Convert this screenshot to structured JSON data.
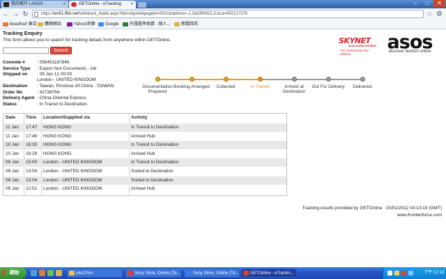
{
  "browser": {
    "tabs": [
      {
        "label": "我的帳戶 | ASOS"
      },
      {
        "label": "GETOnline - eTracking"
      }
    ],
    "window_controls": {
      "minimize": "–",
      "maximize": "□",
      "close": "✕"
    },
    "url_domain": "wn01.ffdx.net",
    "url_rest": "/v4/etrack_blank.aspx?ttid=skynet&pageid=0001&options=,1,2&GB0022,3,&ca=002217376",
    "url_scheme": "https://",
    "bookmarks": [
      {
        "label": "beauthat! 東亞",
        "color": "#e07b39"
      },
      {
        "label": "購物網站",
        "color": "#d9b44a"
      },
      {
        "label": "Yahoo!奇摩",
        "color": "#7b1fa2"
      },
      {
        "label": "Google",
        "color": "#4285f4"
      },
      {
        "label": "外匯匯率換算 - 個人...",
        "color": "#2e7d32"
      },
      {
        "label": "新聞資訊",
        "color": "#d9b44a"
      }
    ]
  },
  "page": {
    "title": "Tracking Enquiry",
    "intro": "This form allows you to search for tracking details from anywhere within GETOnline.",
    "search": {
      "value": "",
      "button_label": "Search"
    },
    "logos": {
      "skynet_word": "SKYNET",
      "skynet_sub": "WORLDWIDE EXPRESS",
      "skynet_tag": "The Partnership that delivers",
      "asos_word": "asos",
      "asos_tag": "discover fashion online"
    },
    "details": [
      {
        "label": "Connote #",
        "value": ": 056401187846"
      },
      {
        "label": "Service Type",
        "value": ": Export Non Documents - Intl"
      },
      {
        "label": "Shipped on",
        "value": ": 09 Jan 12 00:00"
      },
      {
        "label": "",
        "value": "London - UNITED KINGDOM"
      },
      {
        "label": "Destination",
        "value": ": Taiwan, Province Of China - TAIWAN"
      },
      {
        "label": "Order No",
        "value": ": 42738764"
      },
      {
        "label": "Delivery Agent",
        "value": ": China-Oriental Express"
      },
      {
        "label": "Status",
        "value": ": In Transit to Destination"
      }
    ],
    "progress": {
      "steps": [
        {
          "label": "Documentation Prepared",
          "state": "done"
        },
        {
          "label": "Booking Arranged",
          "state": "done"
        },
        {
          "label": "Collected",
          "state": "done"
        },
        {
          "label": "In Transit",
          "state": "current"
        },
        {
          "label": "Arrived at Destination",
          "state": "pending"
        },
        {
          "label": "Out For Delivery",
          "state": "pending"
        },
        {
          "label": "Delivered",
          "state": "pending"
        }
      ],
      "colors": {
        "done": "#e3a31c",
        "current": "#e98b1a",
        "pending": "#9a9a9a",
        "current_label": "#e98b1a"
      }
    },
    "table": {
      "headers": [
        "Date",
        "Time",
        "Location/Supplied via",
        "Activity"
      ],
      "rows": [
        [
          "11 Jan",
          "17:47",
          "HONG KONG",
          "In Transit to Destination"
        ],
        [
          "11 Jan",
          "17:46",
          "HONG KONG",
          "Arrived Hub"
        ],
        [
          "10 Jan",
          "16:30",
          "HONG KONG",
          "In Transit to Destination"
        ],
        [
          "10 Jan",
          "16:29",
          "HONG KONG",
          "Arrived Hub"
        ],
        [
          "09 Jan",
          "15:00",
          "London - UNITED KINGDOM",
          "In Transit to Destination"
        ],
        [
          "09 Jan",
          "13:04",
          "London - UNITED KINGDOM",
          "Sorted to Destination"
        ],
        [
          "09 Jan",
          "13:04",
          "London - UNITED KINGDOM",
          "Sorted to Destination"
        ],
        [
          "09 Jan",
          "12:52",
          "London - UNITED KINGDOM",
          "Arrived Hub"
        ]
      ]
    },
    "footer": {
      "provided": "Tracking results provided by GETOnline : 15/01/2012 04:13:19 (GMT)",
      "site": "www.frontierforce.com"
    }
  },
  "taskbar": {
    "start_label": "開始",
    "tasks": [
      {
        "label": "o&c2Yuri",
        "active": false,
        "color": "#f0c24a"
      },
      {
        "label": "Sony Store, Online (Ta...",
        "active": false,
        "color": "#e0402a"
      },
      {
        "label": "Sony Store, Online (Ta...",
        "active": false,
        "color": "#3a7de0"
      },
      {
        "label": "GETOnline - eTrackin...",
        "active": true,
        "color": "#e0402a"
      }
    ],
    "clock": "下午 12:13"
  }
}
